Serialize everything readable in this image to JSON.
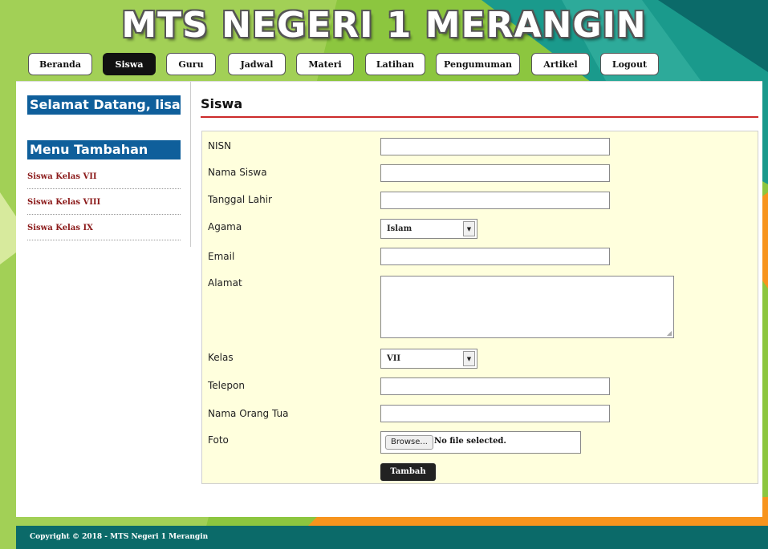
{
  "header": {
    "title": "MTS NEGERI 1 MERANGIN"
  },
  "nav": {
    "items": [
      {
        "label": "Beranda"
      },
      {
        "label": "Siswa"
      },
      {
        "label": "Guru"
      },
      {
        "label": "Jadwal"
      },
      {
        "label": "Materi"
      },
      {
        "label": "Latihan"
      },
      {
        "label": "Pengumuman"
      },
      {
        "label": "Artikel"
      },
      {
        "label": "Logout"
      }
    ],
    "active": "Siswa"
  },
  "sidebar": {
    "welcome": "Selamat Datang, lisa",
    "menu_title": "Menu Tambahan",
    "links": [
      {
        "label": "Siswa Kelas VII"
      },
      {
        "label": "Siswa Kelas VIII"
      },
      {
        "label": "Siswa Kelas IX"
      }
    ]
  },
  "main": {
    "title": "Siswa",
    "form": {
      "nisn_label": "NISN",
      "nama_label": "Nama Siswa",
      "tanggal_label": "Tanggal Lahir",
      "agama_label": "Agama",
      "agama_value": "Islam",
      "email_label": "Email",
      "alamat_label": "Alamat",
      "kelas_label": "Kelas",
      "kelas_value": "VII",
      "telepon_label": "Telepon",
      "orangtua_label": "Nama Orang Tua",
      "foto_label": "Foto",
      "browse_label": "Browse...",
      "file_status": "No file selected.",
      "submit_label": "Tambah"
    }
  },
  "footer": {
    "text": "Copyright © 2018 - MTS Negeri 1 Merangin"
  },
  "colors": {
    "header_bg": "#8cc63f",
    "teal": "#0b6a69",
    "sidebar_head": "#0f5f9b",
    "link": "#8b1a1a",
    "form_bg": "#ffffdd",
    "heading_rule": "#cc2a2a",
    "orange": "#f7941d"
  }
}
